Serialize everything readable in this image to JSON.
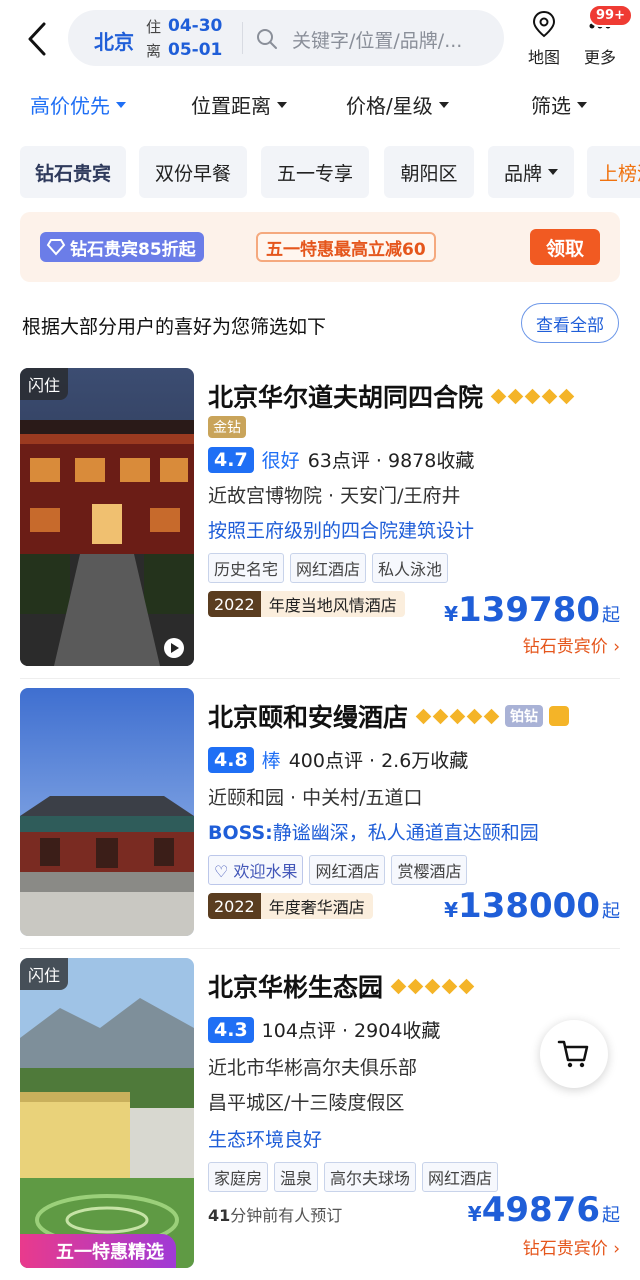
{
  "header": {
    "city": "北京",
    "checkin_label": "住",
    "checkin_date": "04-30",
    "checkout_label": "离",
    "checkout_date": "05-01",
    "search_placeholder": "关键字/位置/品牌/...",
    "map_label": "地图",
    "more_label": "更多",
    "more_badge": "99+"
  },
  "sort": {
    "items": [
      "高价优先",
      "位置距离",
      "价格/星级",
      "筛选"
    ],
    "active_index": 0
  },
  "chips": [
    "钻石贵宾",
    "双份早餐",
    "五一专享",
    "朝阳区",
    "品牌",
    "上榜酒"
  ],
  "promo": {
    "vip": "钻石贵宾85折起",
    "deal": "五一特惠最高立减60",
    "claim": "领取"
  },
  "filter_tip": "根据大部分用户的喜好为您筛选如下",
  "view_all": "查看全部",
  "hotels": [
    {
      "flash": "闪住",
      "name": "北京华尔道夫胡同四合院",
      "tier": "金钻",
      "score": "4.7",
      "rating_word": "很好",
      "reviews": "63点评 · 9878收藏",
      "location": "近故宫博物院 · 天安门/王府井",
      "feature": "按照王府级别的四合院建筑设计",
      "tags": [
        "历史名宅",
        "网红酒店",
        "私人泳池"
      ],
      "award_year": "2022",
      "award": "年度当地风情酒店",
      "currency": "¥",
      "price": "139780",
      "price_suffix": "起",
      "vip_price": "钻石贵宾价 ›"
    },
    {
      "name": "北京颐和安缦酒店",
      "tier": "铂钻",
      "score": "4.8",
      "rating_word": "棒",
      "reviews": "400点评 · 2.6万收藏",
      "location": "近颐和园 · 中关村/五道口",
      "feature_boss": "BOSS:",
      "feature": "静谧幽深，私人通道直达颐和园",
      "tags": [
        "欢迎水果",
        "网红酒店",
        "赏樱酒店"
      ],
      "award_year": "2022",
      "award": "年度奢华酒店",
      "currency": "¥",
      "price": "138000",
      "price_suffix": "起"
    },
    {
      "flash": "闪住",
      "name": "北京华彬生态园",
      "score": "4.3",
      "reviews": "104点评 · 2904收藏",
      "location_1": "近北市华彬高尔夫俱乐部",
      "location_2": "昌平城区/十三陵度假区",
      "feature": "生态环境良好",
      "tags": [
        "家庭房",
        "温泉",
        "高尔夫球场",
        "网红酒店"
      ],
      "recent_num": "41",
      "recent": "分钟前有人预订",
      "currency": "¥",
      "price": "49876",
      "price_suffix": "起",
      "vip_price": "钻石贵宾价 ›",
      "promo_ribbon": "五一特惠精选"
    }
  ],
  "colors": {
    "accent": "#1f6ff5",
    "price": "#1f5ed8",
    "orange": "#f15a22",
    "badge": "#ef3b33"
  }
}
